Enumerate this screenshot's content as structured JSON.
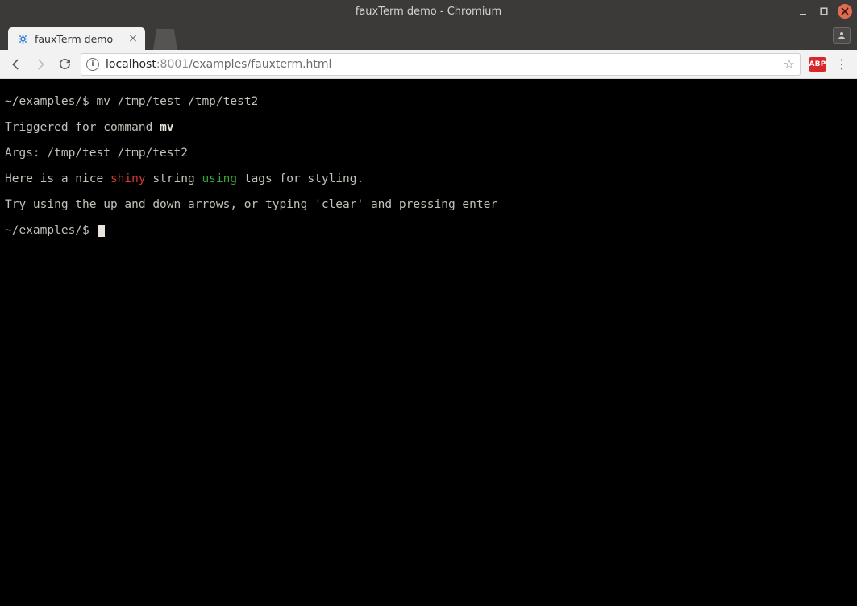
{
  "window": {
    "title": "fauxTerm demo - Chromium"
  },
  "browser": {
    "tab_title": "fauxTerm demo",
    "url_host": "localhost",
    "url_port": ":8001",
    "url_path": "/examples/fauxterm.html",
    "ext_abp_label": "ABP"
  },
  "terminal": {
    "prompt": "~/examples/$ ",
    "command_input": "mv /tmp/test /tmp/test2",
    "line_trigger_pre": "Triggered for command ",
    "line_trigger_cmd": "mv",
    "line_args": "Args: /tmp/test /tmp/test2",
    "styled_pre": "Here is a nice ",
    "styled_red": "shiny",
    "styled_mid": " string ",
    "styled_green": "using",
    "styled_post": " tags for styling.",
    "line_hint": "Try using the up and down arrows, or typing 'clear' and pressing enter",
    "prompt2": "~/examples/$ "
  }
}
